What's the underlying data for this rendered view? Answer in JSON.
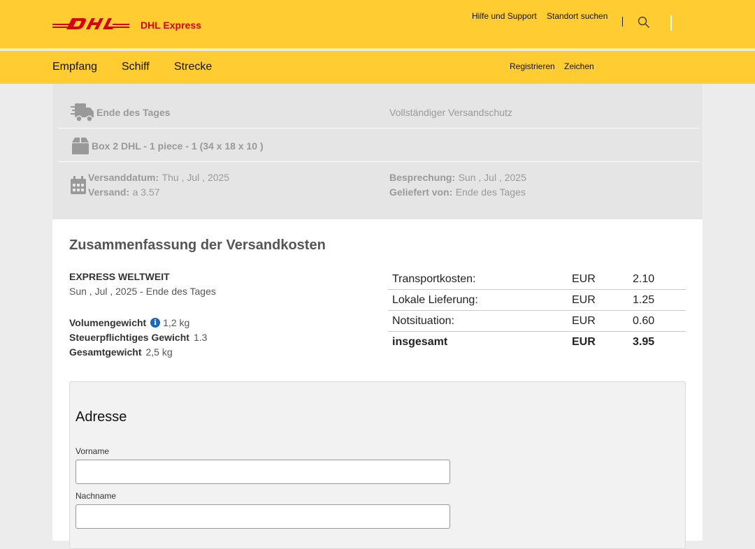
{
  "header": {
    "logo_text": "DHL Express",
    "links": [
      "Hilfe und Support",
      "Standort suchen"
    ],
    "brand_colors": {
      "yellow": "#ffcc32",
      "red": "#d40511"
    }
  },
  "nav": {
    "items": [
      "Empfang",
      "Schiff",
      "Strecke"
    ],
    "register": "Registrieren",
    "sign": "Zeichen"
  },
  "info": {
    "delivery_time": "Ende des Tages",
    "protection": "Vollständiger Versandschutz",
    "package": "Box 2 DHL - 1 piece - 1 (34 x 18 x 10 )",
    "ship_date_label": "Versanddatum:",
    "ship_date_value": "Thu , Jul , 2025",
    "shipment_label": "Versand:",
    "shipment_value": "a 3.57",
    "review_label": "Besprechung:",
    "review_value": "Sun , Jul , 2025",
    "delivered_by_label": "Geliefert von:",
    "delivered_by_value": "Ende des Tages"
  },
  "summary": {
    "title": "Zusammenfassung der Versandkosten",
    "service": "EXPRESS WELTWEIT",
    "service_date": "Sun , Jul , 2025 - Ende des Tages",
    "volume_label": "Volumengewicht",
    "volume_value": "1,2 kg",
    "taxable_label": "Steuerpflichtiges Gewicht",
    "taxable_value": "1.3",
    "total_weight_label": "Gesamtgewicht",
    "total_weight_value": "2,5 kg",
    "costs": [
      {
        "label": "Transportkosten:",
        "currency": "EUR",
        "amount": "2.10"
      },
      {
        "label": "Lokale Lieferung:",
        "currency": "EUR",
        "amount": "1.25"
      },
      {
        "label": "Notsituation:",
        "currency": "EUR",
        "amount": "0.60"
      },
      {
        "label": "insgesamt",
        "currency": "EUR",
        "amount": "3.95"
      }
    ]
  },
  "address": {
    "title": "Adresse",
    "first_name_label": "Vorname",
    "first_name_value": "",
    "last_name_label": "Nachname",
    "last_name_value": ""
  }
}
